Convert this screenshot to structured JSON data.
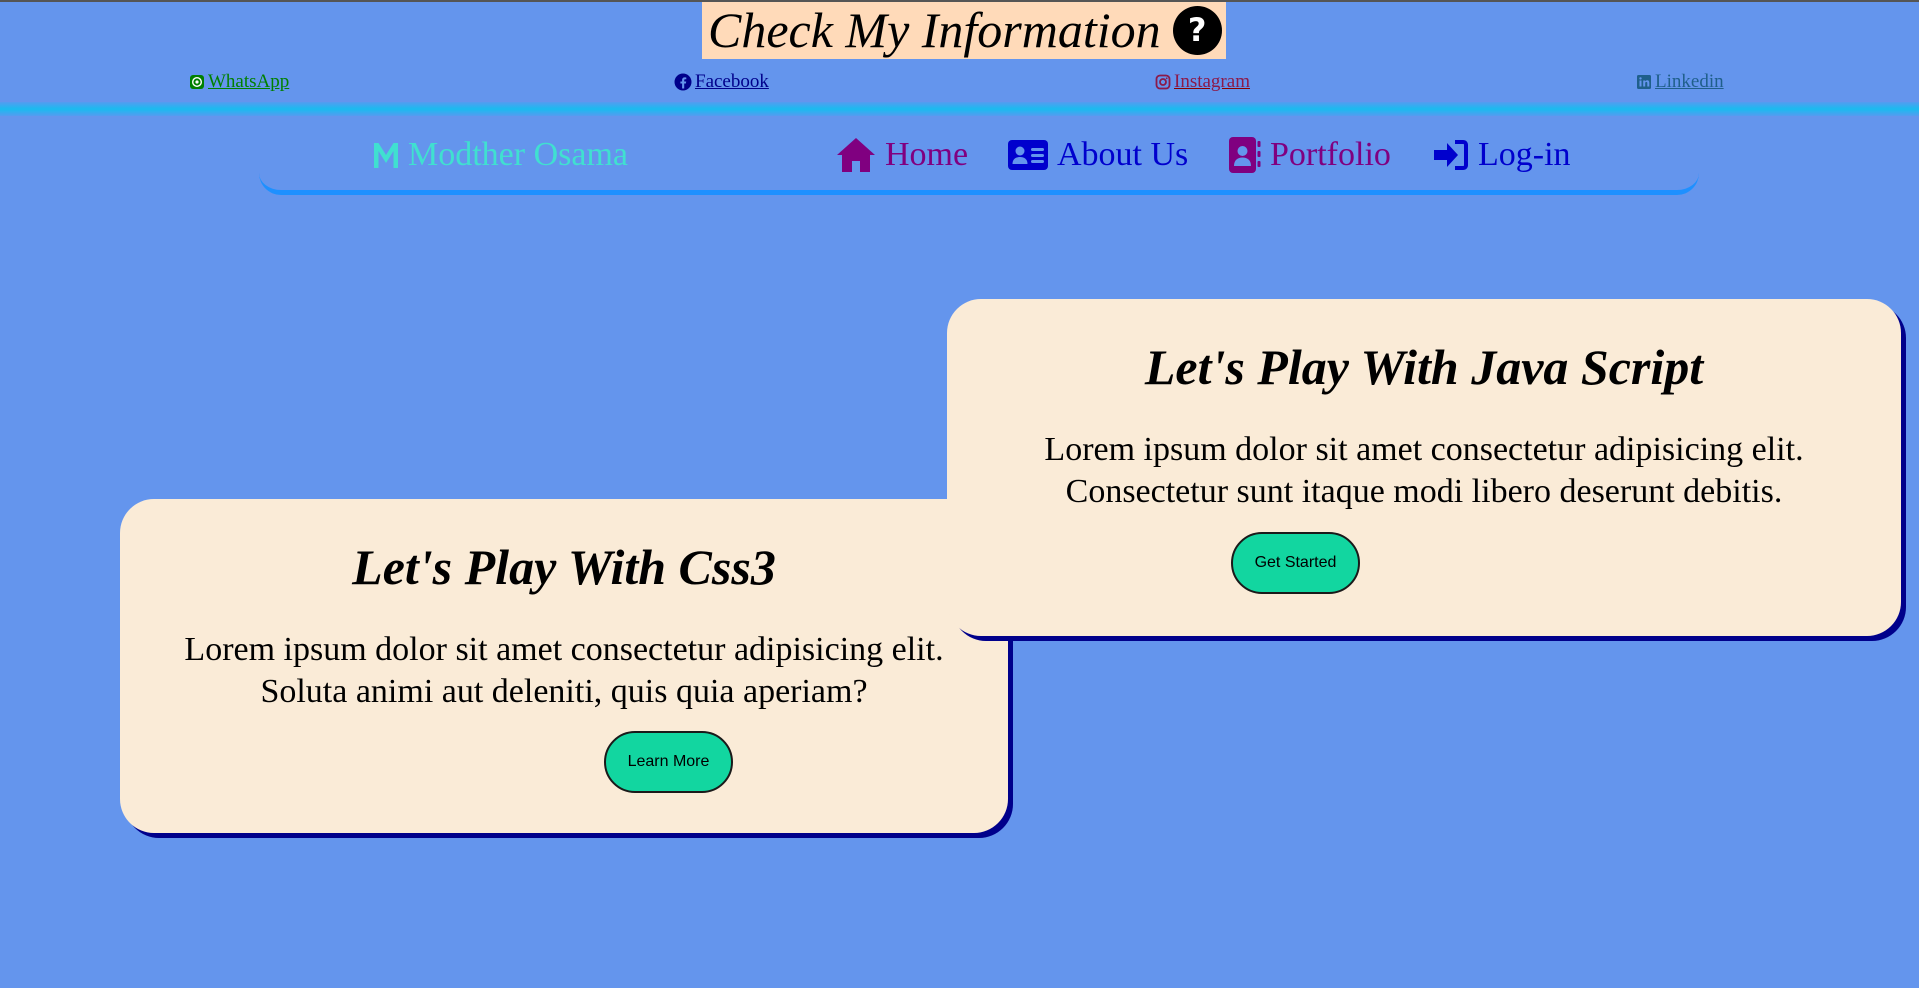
{
  "header": {
    "title": "Check My Information",
    "help_icon": "question-circle-icon",
    "help_glyph": "?",
    "highlight_color": "#ffdab9"
  },
  "social_links": [
    {
      "label": " WhatsApp",
      "icon": "whatsapp-icon",
      "color": "#008000"
    },
    {
      "label": " Facebook",
      "icon": "facebook-icon",
      "color": "#00008b"
    },
    {
      "label": " Instagram",
      "icon": "instagram-icon",
      "color": "#8b1a4a"
    },
    {
      "label": " Linkedin",
      "icon": "linkedin-icon",
      "color": "#1f5f8b"
    }
  ],
  "navbar": {
    "brand": {
      "label": "Modther Osama",
      "icon": "m-logo-icon",
      "color": "#40e0d0"
    },
    "items": [
      {
        "label": "Home",
        "icon": "house-icon",
        "color": "#800080"
      },
      {
        "label": "About Us",
        "icon": "address-card-icon",
        "color": "#0000cd"
      },
      {
        "label": "Portfolio",
        "icon": "contact-book-icon",
        "color": "#800080"
      },
      {
        "label": "Log-in",
        "icon": "sign-in-icon",
        "color": "#0000cd"
      }
    ]
  },
  "cards": [
    {
      "title": "Let's Play With Css3",
      "line1": "Lorem ipsum dolor sit amet consectetur adipisicing elit.",
      "line2": "Soluta animi aut deleniti, quis quia aperiam?",
      "button": "Learn More"
    },
    {
      "title": "Let's Play With Java Script",
      "line1": "Lorem ipsum dolor sit amet consectetur adipisicing elit.",
      "line2": "Consectetur sunt itaque modi libero deserunt debitis.",
      "button": "Get Started"
    }
  ],
  "colors": {
    "background": "#6495ed",
    "card_background": "#faebd7",
    "button_background": "#12d6a0",
    "accent_border": "#1e90ff",
    "card_shadow": "#00008b"
  }
}
